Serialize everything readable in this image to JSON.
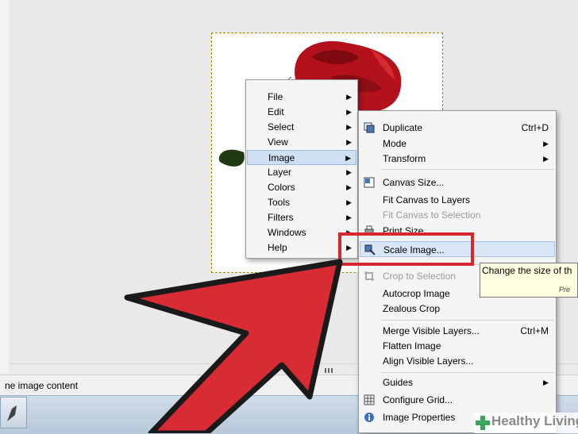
{
  "status": {
    "text": "ne image content"
  },
  "main_menu": {
    "items": [
      {
        "label": "File",
        "submenu": true
      },
      {
        "label": "Edit",
        "submenu": true
      },
      {
        "label": "Select",
        "submenu": true
      },
      {
        "label": "View",
        "submenu": true
      },
      {
        "label": "Image",
        "submenu": true,
        "highlighted": true
      },
      {
        "label": "Layer",
        "submenu": true
      },
      {
        "label": "Colors",
        "submenu": true
      },
      {
        "label": "Tools",
        "submenu": true
      },
      {
        "label": "Filters",
        "submenu": true
      },
      {
        "label": "Windows",
        "submenu": true
      },
      {
        "label": "Help",
        "submenu": true
      }
    ]
  },
  "image_menu": {
    "items": [
      {
        "label": "Duplicate",
        "shortcut": "Ctrl+D",
        "icon": "duplicate-icon"
      },
      {
        "label": "Mode",
        "submenu": true
      },
      {
        "label": "Transform",
        "submenu": true
      },
      {
        "label": "Canvas Size...",
        "icon": "canvas-size-icon"
      },
      {
        "label": "Fit Canvas to Layers"
      },
      {
        "label": "Fit Canvas to Selection",
        "disabled": true
      },
      {
        "label": "Print Size...",
        "icon": "print-size-icon"
      },
      {
        "label": "Scale Image...",
        "icon": "scale-image-icon",
        "highlighted": true
      },
      {
        "label": "Crop to Selection",
        "icon": "crop-icon",
        "disabled": true
      },
      {
        "label": "Autocrop Image"
      },
      {
        "label": "Zealous Crop"
      },
      {
        "label": "Merge Visible Layers...",
        "shortcut": "Ctrl+M"
      },
      {
        "label": "Flatten Image"
      },
      {
        "label": "Align Visible Layers..."
      },
      {
        "label": "Guides",
        "submenu": true
      },
      {
        "label": "Configure Grid...",
        "icon": "grid-icon"
      },
      {
        "label": "Image Properties",
        "icon": "info-icon"
      }
    ]
  },
  "tooltip": {
    "text": "Change the size of th",
    "sub": "Pre"
  },
  "watermark": {
    "text": "Healthy Living"
  },
  "colors": {
    "highlight_box": "#d2282e",
    "arrow": "#d92b34",
    "rose": "#b3121c"
  }
}
